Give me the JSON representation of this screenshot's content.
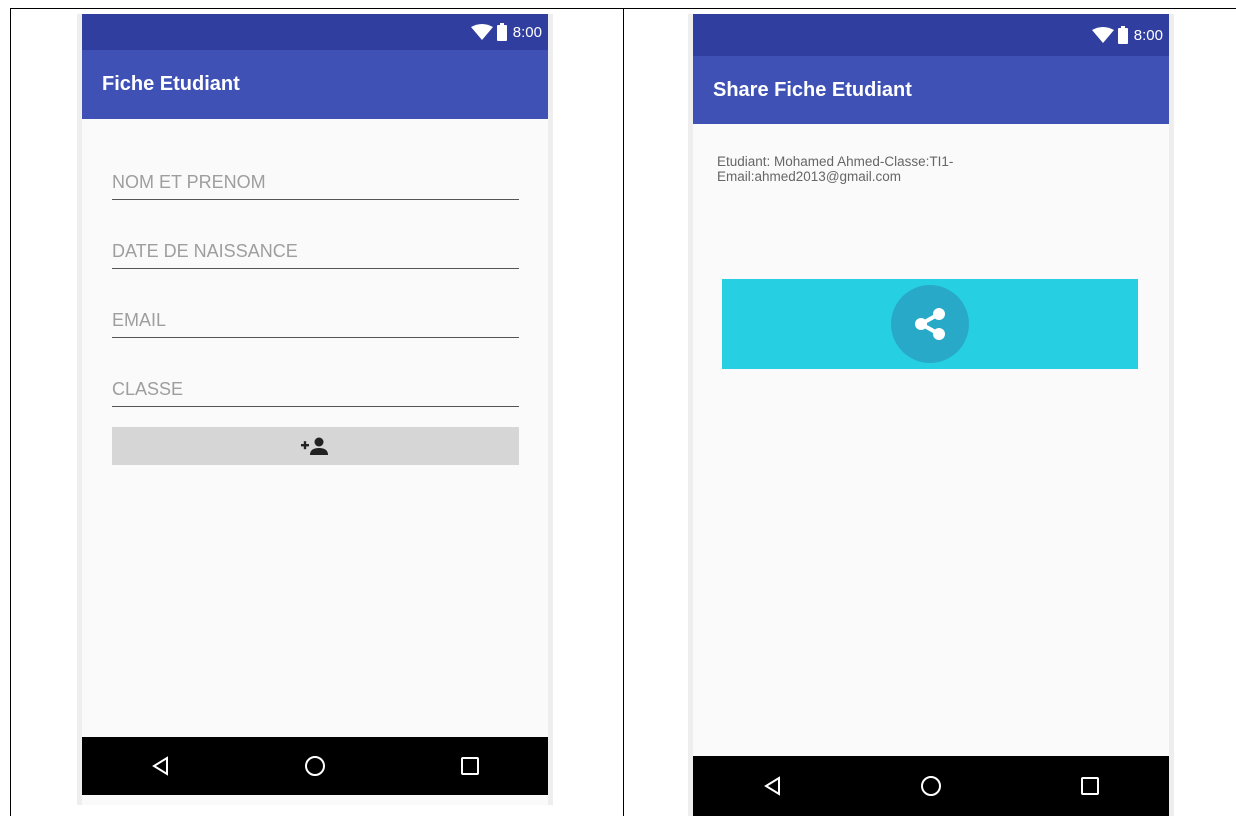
{
  "left_screen": {
    "status": {
      "time": "8:00"
    },
    "app_bar": {
      "title": "Fiche Etudiant"
    },
    "form": {
      "name_placeholder": "NOM ET PRENOM",
      "birthdate_placeholder": "DATE DE NAISSANCE",
      "email_placeholder": "EMAIL",
      "class_placeholder": "CLASSE"
    },
    "add_button_icon": "person-add-icon"
  },
  "right_screen": {
    "status": {
      "time": "8:00"
    },
    "app_bar": {
      "title": "Share Fiche Etudiant"
    },
    "student_info_line1": "Etudiant: Mohamed Ahmed-Classe:TI1-",
    "student_info_line2": "Email:ahmed2013@gmail.com",
    "share_button_icon": "share-icon"
  },
  "nav_icons": [
    "back-icon",
    "home-icon",
    "recents-icon"
  ],
  "colors": {
    "status_bar": "#303f9f",
    "app_bar": "#3f51b5",
    "share_button": "#26d0e2",
    "share_circle": "#28a9c8",
    "nav_bar": "#000000"
  }
}
